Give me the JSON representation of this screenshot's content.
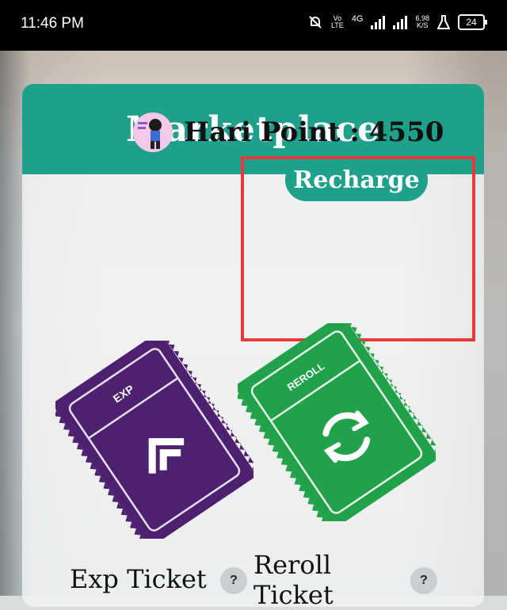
{
  "status_bar": {
    "time": "11:46 PM",
    "network_top": "Vo",
    "network_bottom": "LTE",
    "network_type": "4G",
    "speed_value": "6.98",
    "speed_unit": "K/S",
    "battery": "24"
  },
  "marketplace": {
    "title": "Marketplace",
    "points_label": "Hari Point : 4550",
    "recharge_label": "Recharge"
  },
  "tickets": [
    {
      "name": "Exp Ticket",
      "badge": "EXP",
      "help": "?",
      "color": "#4e2170"
    },
    {
      "name": "Reroll Ticket",
      "badge": "REROLL",
      "help": "?",
      "color": "#21a24a"
    }
  ],
  "colors": {
    "accent": "#1ea08a",
    "highlight": "#e53b3b"
  }
}
